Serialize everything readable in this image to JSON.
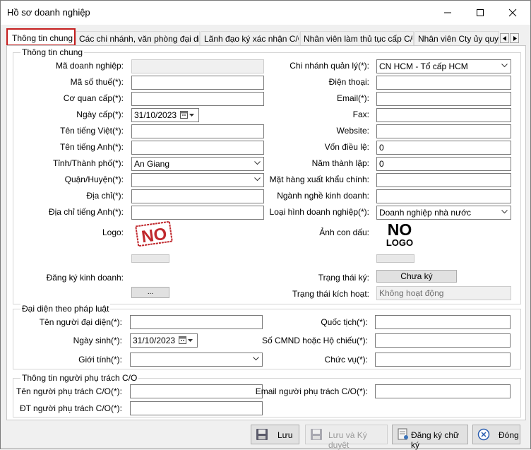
{
  "window": {
    "title": "Hồ sơ doanh nghiệp"
  },
  "tabs": [
    "Thông tin chung",
    "Các chi nhánh, văn phòng đại diện",
    "Lãnh đạo ký xác nhận C/O",
    "Nhân viên làm thủ tục cấp C/O",
    "Nhân viên Cty ủy quyền"
  ],
  "general": {
    "group_title": "Thông tin chung",
    "left": {
      "ma_dn_label": "Mã doanh nghiệp:",
      "ma_dn_value": "",
      "mst_label": "Mã số thuế(*):",
      "mst_value": "",
      "co_quan_cap_label": "Cơ quan cấp(*):",
      "co_quan_cap_value": "",
      "ngay_cap_label": "Ngày cấp(*):",
      "ngay_cap_value": "31/10/2023",
      "ten_viet_label": "Tên tiếng Việt(*):",
      "ten_viet_value": "",
      "ten_anh_label": "Tên tiếng Anh(*):",
      "ten_anh_value": "",
      "tinh_label": "Tỉnh/Thành phố(*):",
      "tinh_value": "An Giang",
      "quan_label": "Quận/Huyện(*):",
      "quan_value": "",
      "dia_chi_label": "Địa chỉ(*):",
      "dia_chi_value": "",
      "dia_chi_anh_label": "Địa chỉ tiếng Anh(*):",
      "dia_chi_anh_value": "",
      "logo_label": "Logo:",
      "logo_text": "NO",
      "dkkd_label": "Đăng ký kinh doanh:",
      "browse_label": "..."
    },
    "right": {
      "chi_nhanh_label": "Chi nhánh quản lý(*):",
      "chi_nhanh_value": "CN HCM - Tổ cấp HCM",
      "dien_thoai_label": "Điện thoại:",
      "dien_thoai_value": "",
      "email_label": "Email(*):",
      "email_value": "",
      "fax_label": "Fax:",
      "fax_value": "",
      "website_label": "Website:",
      "website_value": "",
      "von_label": "Vốn điều lệ:",
      "von_value": "0",
      "nam_tl_label": "Năm thành lập:",
      "nam_tl_value": "0",
      "mat_hang_label": "Mặt hàng xuất khẩu chính:",
      "mat_hang_value": "",
      "nganh_nghe_label": "Ngành nghề kinh doanh:",
      "nganh_nghe_value": "",
      "loai_hinh_label": "Loại hình doanh nghiệp(*):",
      "loai_hinh_value": "Doanh nghiệp nhà nước",
      "anh_dau_label": "Ảnh con dấu:",
      "seal_line1": "NO",
      "seal_line2": "LOGO",
      "trang_thai_ky_label": "Trạng thái ký:",
      "trang_thai_ky_button": "Chưa ký",
      "trang_thai_kh_label": "Trạng thái kích hoạt:",
      "trang_thai_kh_value": "Không hoạt động"
    }
  },
  "legal": {
    "group_title": "Đại diện theo pháp luật",
    "ten_label": "Tên người đại diện(*):",
    "ten_value": "",
    "ngay_sinh_label": "Ngày sinh(*):",
    "ngay_sinh_value": "31/10/2023",
    "gioi_tinh_label": "Giới tính(*):",
    "gioi_tinh_value": "",
    "quoc_tich_label": "Quốc tịch(*):",
    "quoc_tich_value": "",
    "cmnd_label": "Số CMND hoặc Hộ chiếu(*):",
    "cmnd_value": "",
    "chuc_vu_label": "Chức vụ(*):",
    "chuc_vu_value": ""
  },
  "co_person": {
    "group_title": "Thông tin người phụ trách C/O",
    "ten_label": "Tên người phụ trách C/O(*):",
    "ten_value": "",
    "dt_label": "ĐT người phụ trách C/O(*):",
    "dt_value": "",
    "email_label": "Email người phụ trách C/O(*):",
    "email_value": ""
  },
  "footer": {
    "save": "Lưu",
    "save_approve": "Lưu và Ký duyệt",
    "register_sign": "Đăng ký chữ ký",
    "close": "Đóng"
  },
  "colors": {
    "active_tab_border": "#c41e1e",
    "logo_red": "#c0282d"
  }
}
